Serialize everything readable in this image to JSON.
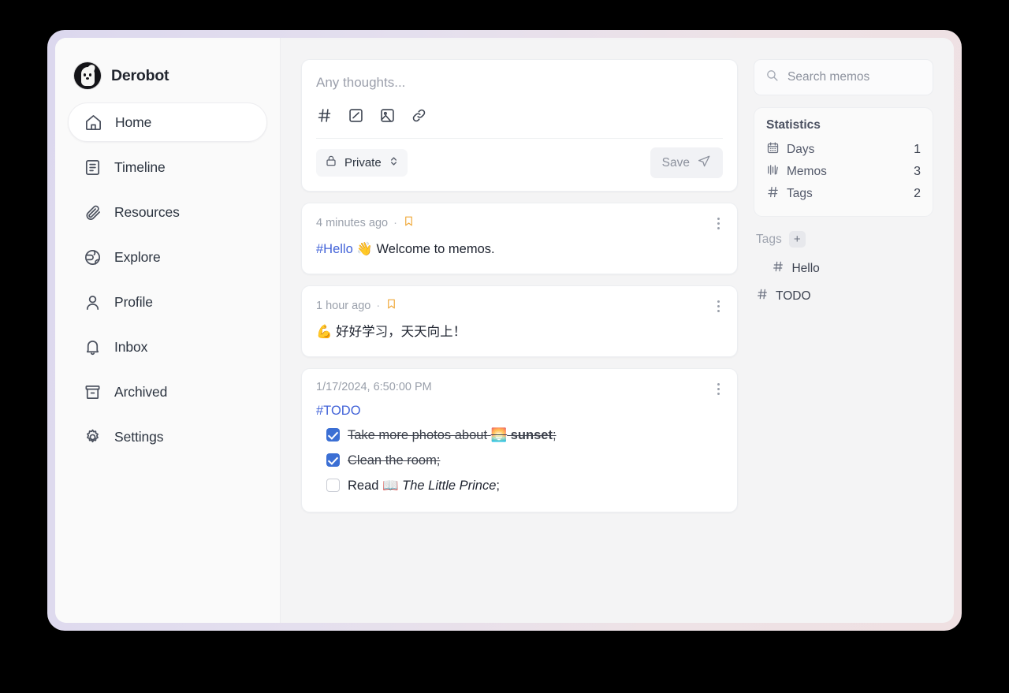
{
  "app": {
    "brand_name": "Derobot",
    "avatar_icon": "derobot-avatar"
  },
  "sidebar": {
    "items": [
      {
        "label": "Home",
        "icon": "home-icon",
        "active": true
      },
      {
        "label": "Timeline",
        "icon": "timeline-icon",
        "active": false
      },
      {
        "label": "Resources",
        "icon": "paperclip-icon",
        "active": false
      },
      {
        "label": "Explore",
        "icon": "globe-icon",
        "active": false
      },
      {
        "label": "Profile",
        "icon": "user-icon",
        "active": false
      },
      {
        "label": "Inbox",
        "icon": "bell-icon",
        "active": false
      },
      {
        "label": "Archived",
        "icon": "archive-icon",
        "active": false
      },
      {
        "label": "Settings",
        "icon": "gear-icon",
        "active": false
      }
    ]
  },
  "editor": {
    "placeholder": "Any thoughts...",
    "value": "",
    "tools": [
      {
        "icon": "hash-icon"
      },
      {
        "icon": "checkbox-task-icon"
      },
      {
        "icon": "image-icon"
      },
      {
        "icon": "link-icon"
      }
    ],
    "visibility": {
      "label": "Private",
      "icon": "lock-icon",
      "chevron": "chevron-up-down-icon"
    },
    "save": {
      "label": "Save",
      "icon": "send-icon"
    }
  },
  "memos": [
    {
      "time": "4 minutes ago",
      "separator": "·",
      "bookmarked": true,
      "content_parts": [
        {
          "type": "tag",
          "text": "#Hello"
        },
        {
          "type": "emoji",
          "text": "👋"
        },
        {
          "type": "text",
          "text": "Welcome to memos."
        }
      ]
    },
    {
      "time": "1 hour ago",
      "separator": "·",
      "bookmarked": true,
      "content_parts": [
        {
          "type": "emoji",
          "text": "💪"
        },
        {
          "type": "text",
          "text": "好好学习，天天向上！"
        }
      ]
    },
    {
      "time": "1/17/2024, 6:50:00 PM",
      "bookmarked": false,
      "tag": "#TODO",
      "tasks": [
        {
          "checked": true,
          "parts": [
            {
              "type": "text",
              "text": "Take more photos about "
            },
            {
              "type": "emoji",
              "text": "🌅"
            },
            {
              "type": "bold",
              "text": " sunset"
            },
            {
              "type": "text",
              "text": ";"
            }
          ]
        },
        {
          "checked": true,
          "parts": [
            {
              "type": "text",
              "text": "Clean the room;"
            }
          ]
        },
        {
          "checked": false,
          "parts": [
            {
              "type": "text",
              "text": "Read "
            },
            {
              "type": "emoji",
              "text": "📖"
            },
            {
              "type": "italic",
              "text": " The Little Prince"
            },
            {
              "type": "text",
              "text": ";"
            }
          ]
        }
      ]
    }
  ],
  "search": {
    "placeholder": "Search memos",
    "value": "",
    "icon": "search-icon"
  },
  "statistics": {
    "title": "Statistics",
    "rows": [
      {
        "label": "Days",
        "value": "1",
        "icon": "calendar-icon"
      },
      {
        "label": "Memos",
        "value": "3",
        "icon": "bars-icon"
      },
      {
        "label": "Tags",
        "value": "2",
        "icon": "hash-icon"
      }
    ]
  },
  "tags": {
    "title": "Tags",
    "add_label": "+",
    "items": [
      {
        "name": "Hello",
        "icon": "hash-icon"
      },
      {
        "name": "TODO",
        "icon": "hash-icon"
      }
    ]
  },
  "colors": {
    "accent_link": "#4263d8",
    "checkbox_checked": "#3b6fd4",
    "bookmark": "#f0a93a",
    "window_bg": "#f4f4f5",
    "sidebar_bg": "#fafafa"
  }
}
